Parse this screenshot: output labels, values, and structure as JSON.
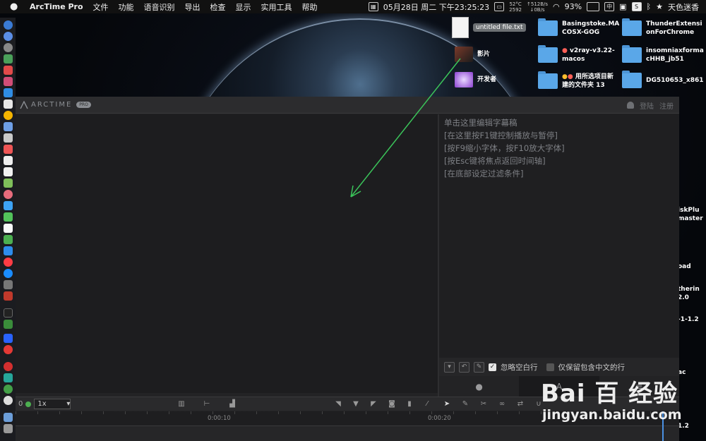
{
  "menubar": {
    "app_name": "ArcTime Pro",
    "menus": [
      "文件",
      "功能",
      "语音识别",
      "导出",
      "检查",
      "显示",
      "实用工具",
      "帮助"
    ],
    "temp": "52°C",
    "fan": "2592",
    "net_up": "↑512B/s",
    "net_down": "↓0B/s",
    "battery": "93%",
    "ime": "中",
    "datetime": "05月28日 周二 下午23:25:23",
    "user": "天色迷香"
  },
  "desktop": {
    "file": "untitled file.txt",
    "items_col1": [
      "影片",
      "开发者"
    ],
    "folders_col2": [
      {
        "line1": "Basingstoke.MA",
        "line2": "COSX-GOG"
      },
      {
        "line1": "v2ray-v3.22-",
        "line2": "macos"
      },
      {
        "line1": "用所选项目新",
        "line2": "建的文件夹 13"
      }
    ],
    "folders_col3": [
      {
        "line1": "ThunderExtensi",
        "line2": "onForChrome"
      },
      {
        "line1": "insomniaxforma",
        "line2": "cHHB_jb51"
      },
      {
        "line1": "DG510653_x861",
        "line2": ""
      }
    ],
    "side_texts": [
      "iskPlu",
      "master",
      "oad",
      "therin",
      "2.0",
      "-1-1.2",
      "ac",
      "1.2"
    ]
  },
  "arctime": {
    "logo_text": "ARCTIME",
    "logo_badge": "PRO",
    "login": "登陆",
    "register": "注册",
    "script_lines": [
      "单击这里编辑字幕稿",
      "[在这里按F1键控制播放与暂停]",
      "[按F9缩小字体，按F10放大字体]",
      "[按Esc键将焦点返回时间轴]",
      "[在底部设定过滤条件]"
    ],
    "filter_ignore_blank": "忽略空白行",
    "filter_ignore_blank_checked": true,
    "filter_chinese_only": "仅保留包含中文的行",
    "filter_chinese_only_checked": false,
    "speed_prefix": "0",
    "speed": "1x",
    "timecodes": [
      "0:00:10",
      "0:00:20"
    ],
    "mode_tab_text": "A"
  },
  "watermark": {
    "brand": "Bai 百 经验",
    "url": "jingyan.baidu.com"
  },
  "colors": {
    "arrow": "#3bc45a",
    "accent": "#4a90e2"
  }
}
